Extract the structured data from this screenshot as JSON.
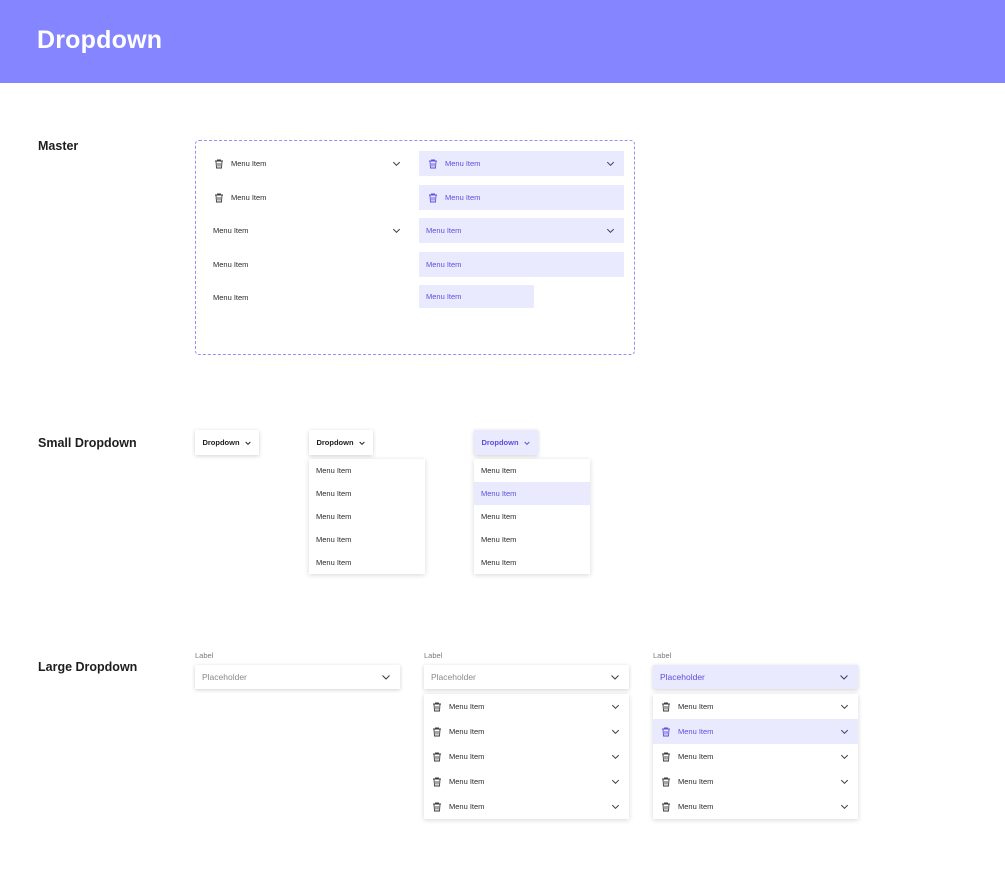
{
  "header": {
    "title": "Dropdown",
    "bg_color": "#8585ff"
  },
  "colors": {
    "accent": "#5a4fdc",
    "highlight_bg": "#eaeafe",
    "frame_border": "#9a8ef0"
  },
  "sections": {
    "master": "Master",
    "small": "Small Dropdown",
    "large": "Large Dropdown"
  },
  "master": {
    "rows": [
      {
        "label": "Menu Item",
        "icon": "trash-icon",
        "chevron": true
      },
      {
        "label": "Menu Item",
        "icon": "trash-icon",
        "chevron": false
      },
      {
        "label": "Menu Item",
        "icon": null,
        "chevron": true
      },
      {
        "label": "Menu Item",
        "icon": null,
        "chevron": false
      },
      {
        "label": "Menu Item",
        "icon": null,
        "chevron": false
      }
    ]
  },
  "small": {
    "button_label": "Dropdown",
    "items": [
      "Menu Item",
      "Menu Item",
      "Menu Item",
      "Menu Item",
      "Menu Item"
    ],
    "highlighted_index": 1
  },
  "large": {
    "label": "Label",
    "placeholder": "Placeholder",
    "items": [
      "Menu Item",
      "Menu Item",
      "Menu Item",
      "Menu Item",
      "Menu Item"
    ],
    "highlighted_index": 1
  }
}
